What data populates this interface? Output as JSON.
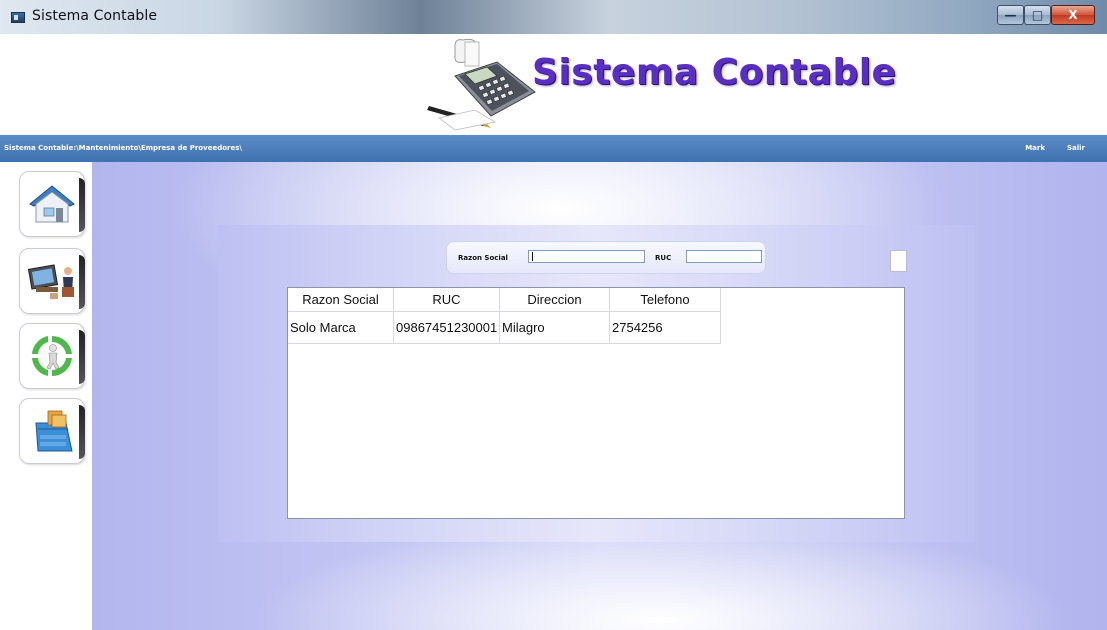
{
  "window": {
    "title": "Sistema Contable",
    "controls": {
      "minimize": "—",
      "maximize": "□",
      "close": "X"
    }
  },
  "header": {
    "app_title": "Sistema Contable",
    "logo_icon": "calculator-pen-icon"
  },
  "navbar": {
    "breadcrumb": "Sistema Contable:\\Mantenimiento\\Empresa de Proveedores\\",
    "user": "Mark",
    "logout": "Salir"
  },
  "sidebar": {
    "items": [
      {
        "icon": "home-icon"
      },
      {
        "icon": "office-desk-icon"
      },
      {
        "icon": "refresh-person-icon"
      },
      {
        "icon": "file-cabinet-icon"
      }
    ]
  },
  "search": {
    "razon_label": "Razon Social",
    "razon_value": "",
    "ruc_label": "RUC",
    "ruc_value": ""
  },
  "table": {
    "columns": [
      "Razon Social",
      "RUC",
      "Direccion",
      "Telefono"
    ],
    "rows": [
      [
        "Solo Marca",
        "09867451230001",
        "Milagro",
        "2754256"
      ]
    ]
  },
  "colors": {
    "title_purple": "#5a2ec2",
    "navbar_blue": "#4a7dbd",
    "main_lavender": "#c4c7f3"
  }
}
